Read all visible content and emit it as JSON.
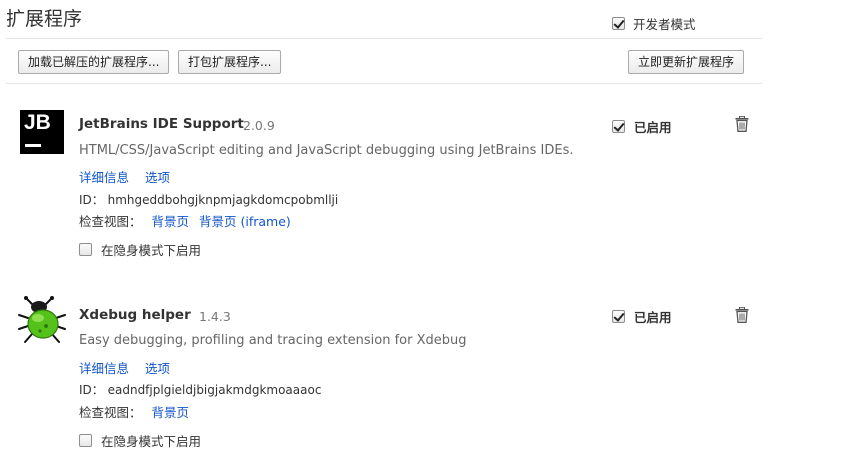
{
  "page": {
    "title": "扩展程序",
    "developer_mode_label": "开发者模式",
    "developer_mode_checked": true
  },
  "toolbar": {
    "load_unpacked_label": "加载已解压的扩展程序...",
    "pack_label": "打包扩展程序...",
    "update_label": "立即更新扩展程序"
  },
  "extensions": [
    {
      "name": "JetBrains IDE Support",
      "version": "2.0.9",
      "description": "HTML/CSS/JavaScript editing and JavaScript debugging using JetBrains IDEs.",
      "details_link": "详细信息",
      "options_link": "选项",
      "id_label": "ID：",
      "id_value": "hmhgeddbohgjknpmjagkdomcpobmllji",
      "views_label": "检查视图：",
      "views": [
        "背景页",
        "背景页 (iframe)"
      ],
      "incognito_label": "在隐身模式下启用",
      "incognito_checked": false,
      "enabled_label": "已启用",
      "enabled_checked": true,
      "icon": "jetbrains-logo-icon"
    },
    {
      "name": "Xdebug helper",
      "version": "1.4.3",
      "description": "Easy debugging, profiling and tracing extension for Xdebug",
      "details_link": "详细信息",
      "options_link": "选项",
      "id_label": "ID：",
      "id_value": "eadndfjplgieldjbigjakmdgkmoaaaoc",
      "views_label": "检查视图：",
      "views": [
        "背景页"
      ],
      "incognito_label": "在隐身模式下启用",
      "incognito_checked": false,
      "enabled_label": "已启用",
      "enabled_checked": true,
      "icon": "green-bug-icon"
    }
  ],
  "colors": {
    "link": "#1155cc",
    "bug_green": "#55c21b",
    "divider": "#e6e6e6"
  }
}
